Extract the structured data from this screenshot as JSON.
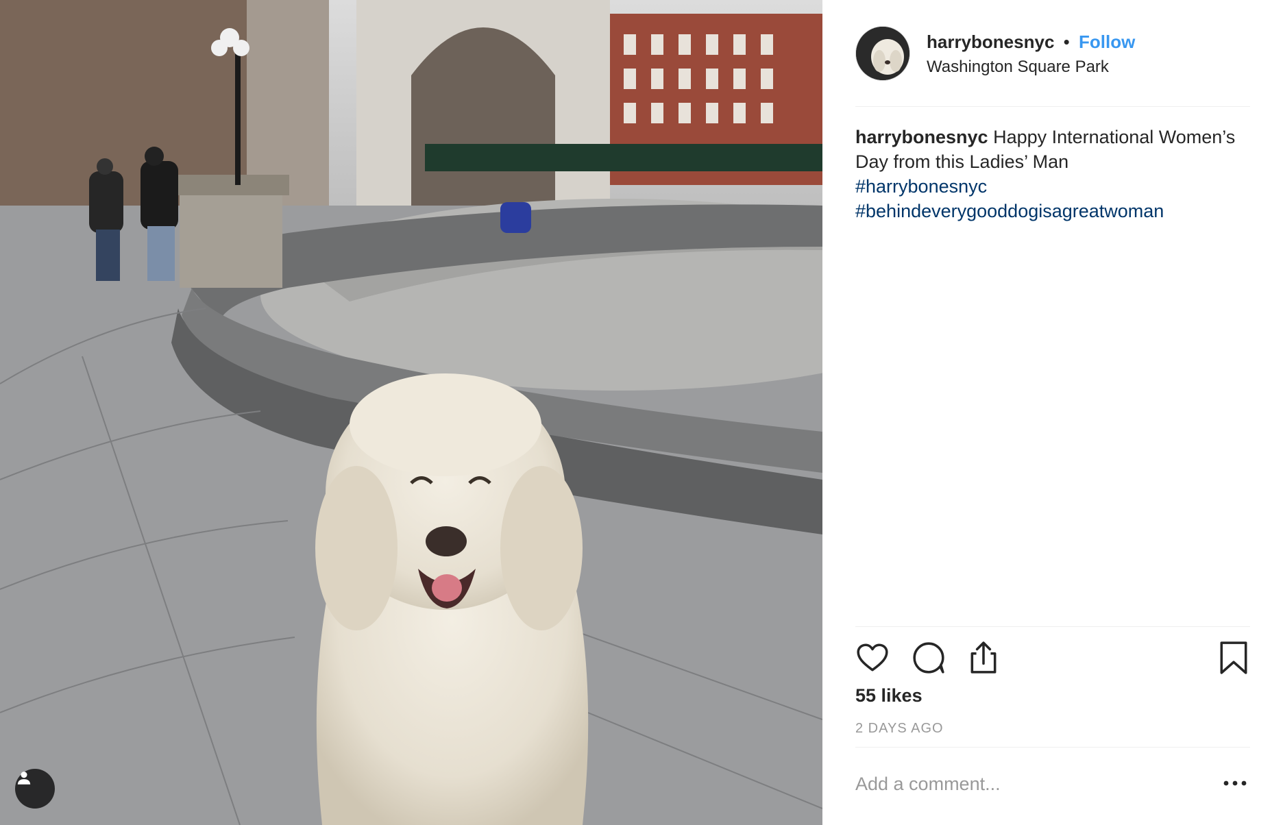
{
  "post": {
    "username": "harrybonesnyc",
    "separator": "•",
    "follow_label": "Follow",
    "location": "Washington Square Park",
    "caption_user": "harrybonesnyc",
    "caption_text": "Happy International Women’s Day from this Ladies’ Man",
    "hashtags": [
      "#harrybonesnyc",
      "#behindeverygooddogisagreatwoman"
    ],
    "likes": "55 likes",
    "time": "2 DAYS AGO",
    "comment_placeholder": "Add a comment..."
  },
  "icons": {
    "like": "heart-icon",
    "comment": "comment-icon",
    "share": "share-icon",
    "save": "bookmark-icon",
    "more": "more-options-icon",
    "user_tags": "user-icon"
  },
  "colors": {
    "link": "#3897f0",
    "hashtag": "#003569",
    "muted": "#999999",
    "text": "#262626"
  }
}
